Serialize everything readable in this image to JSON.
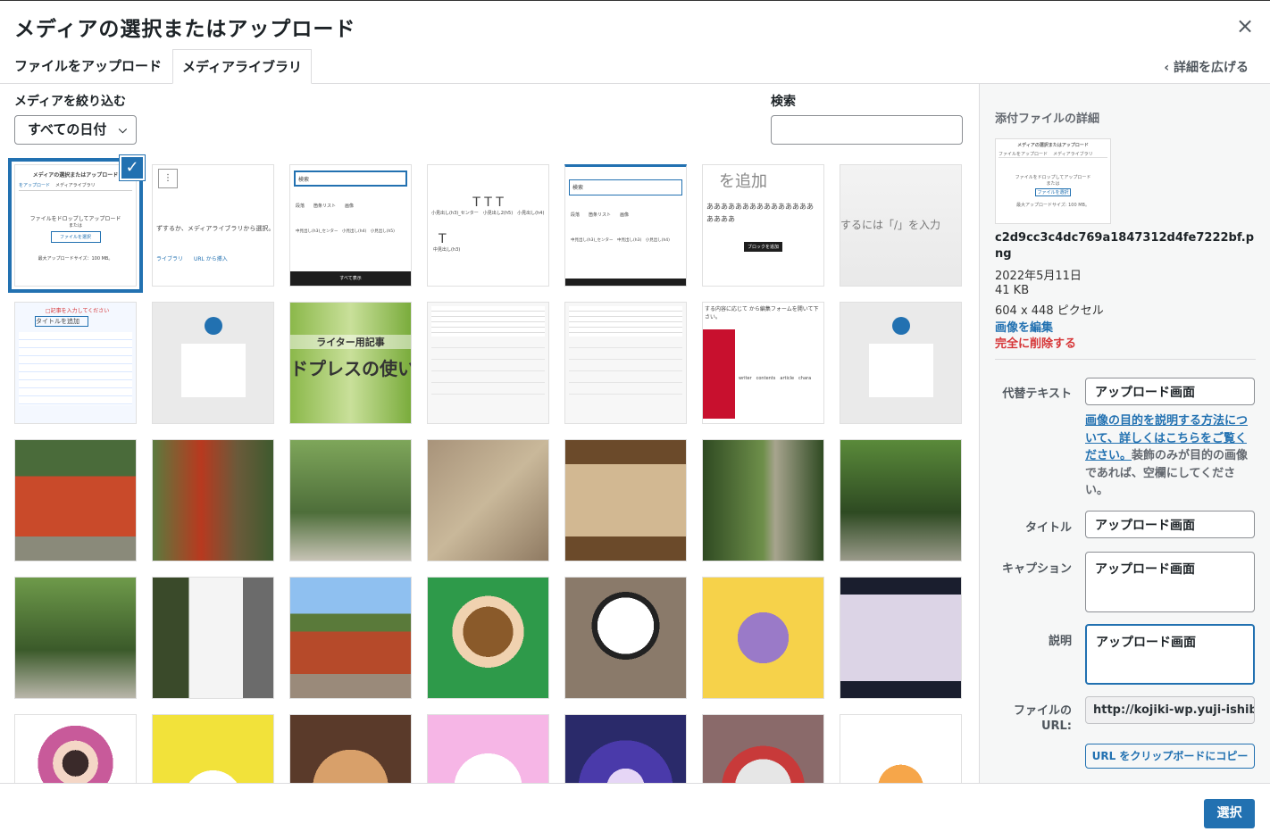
{
  "modal": {
    "title": "メディアの選択またはアップロード",
    "close": "×"
  },
  "tabs": [
    {
      "label": "ファイルをアップロード"
    },
    {
      "label": "メディアライブラリ"
    }
  ],
  "expand_details": "詳細を広げる",
  "filters": {
    "label": "メディアを絞り込む",
    "date_value": "すべての日付",
    "search_label": "検索",
    "search_value": ""
  },
  "attachment": {
    "heading": "添付ファイルの詳細",
    "filename": "c2d9cc3c4dc769a1847312d4fe7222bf.png",
    "date": "2022年5月11日",
    "size": "41 KB",
    "dimensions": "604 x 448 ピクセル",
    "edit_link": "画像を編集",
    "delete_link": "完全に削除する",
    "thumb_title": "メディアの選択またはアップロード",
    "thumb_tab1": "ファイルをアップロード",
    "thumb_tab2": "メディアライブラリ",
    "thumb_drop": "ファイルをドロップしてアップロード",
    "thumb_or": "または",
    "thumb_btn": "ファイルを選択",
    "thumb_max": "最大アップロードサイズ: 100 MB。"
  },
  "fields": {
    "alt_label": "代替テキスト",
    "alt_value": "アップロード画面",
    "help_link": "画像の目的を説明する方法について、詳しくはこちらをご覧ください。",
    "help_text": "装飾のみが目的の画像であれば、空欄にしてください。",
    "title_label": "タイトル",
    "title_value": "アップロード画面",
    "caption_label": "キャプション",
    "caption_value": "アップロード画面",
    "desc_label": "説明",
    "desc_value": "アップロード画面",
    "url_label": "ファイルの URL:",
    "url_value": "http://kojiki-wp.yuji-ishiba",
    "copy_button": "URL をクリップボードにコピー"
  },
  "select_button": "選択",
  "tile_texts": {
    "t0_title": "メディアの選択またはアップロード",
    "t0_tab1": "をアップロード",
    "t0_tab2": "メディアライブラリ",
    "t0_drop": "ファイルをドロップしてアップロード",
    "t0_or": "または",
    "t0_btn": "ファイルを選択",
    "t0_max": "最大アップロードサイズ：100 MB。",
    "t1_text": "ずするか、メディアライブラリから選択。また",
    "t1_links": "ライブラリ　　URL から挿入",
    "t2_search": "検索",
    "t2_items": "段落　　箇条リスト　　画像",
    "t2_items2": "中見出し(h3)_センター　小見出し(h4)　小見出し(h5)",
    "t2_footer": "すべて表示",
    "t3_row1": "小見出し(h3)_センター　小見出し2(h5)　小見出し(h4)",
    "t3_row2": "中見出し(h3)",
    "t4_search": "検索",
    "t4_items": "段落　　箇条リスト　　画像",
    "t4_items2": "中見出し(h3)_センター　中見出し(h3)　小見出し(h4)",
    "t5_title": "を追加",
    "t5_body": "あああああああああああああああああああ",
    "t5_tip": "ブロックを追加",
    "t6_text": "するには「/」を入力",
    "t8_top": "ライター用記事",
    "t8_bottom": "ドプレスの使い",
    "t11_head": "する内容に応じて から編集フォームを開いて下さい。",
    "t11_rows": "writer　contents　article　chara"
  }
}
